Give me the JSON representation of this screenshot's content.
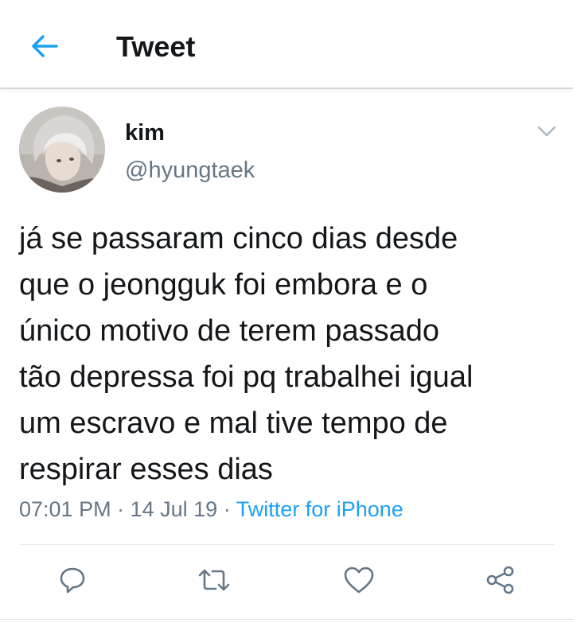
{
  "header": {
    "title": "Tweet",
    "back_icon": "arrow-left-icon",
    "accent": "#1da1f2"
  },
  "tweet": {
    "author_name": "kim",
    "author_handle": "@hyungtaek",
    "text": "já se passaram cinco dias desde\nque o jeongguk foi embora e o\núnico motivo de terem passado\ntão depressa foi pq trabalhei igual\num escravo e mal tive tempo de\nrespirar esses dias",
    "time": "07:01 PM",
    "separator": "·",
    "date": "14 Jul 19",
    "source": "Twitter for iPhone"
  },
  "actions": [
    {
      "name": "reply",
      "icon": "reply-icon"
    },
    {
      "name": "retweet",
      "icon": "retweet-icon"
    },
    {
      "name": "like",
      "icon": "heart-icon"
    },
    {
      "name": "share",
      "icon": "share-icon"
    }
  ],
  "colors": {
    "text": "#14171a",
    "secondary": "#657786",
    "link": "#1da1f2",
    "divider": "#e1e8ed"
  }
}
